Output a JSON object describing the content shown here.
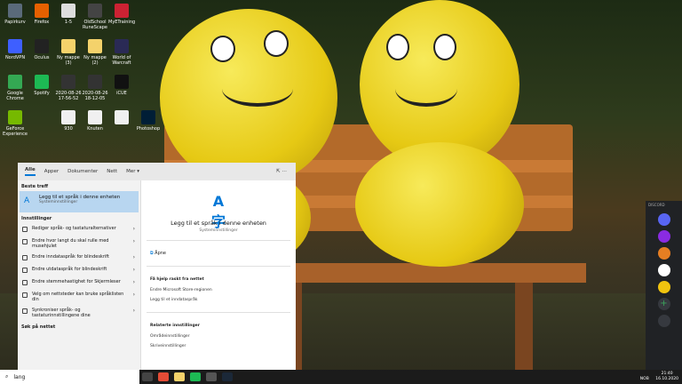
{
  "desktop_icons": [
    {
      "label": "Papirkurv",
      "color": "#5a6a7a"
    },
    {
      "label": "Firefox",
      "color": "#e66000"
    },
    {
      "label": "1-5",
      "color": "#dddddd"
    },
    {
      "label": "OldSchool RuneScape",
      "color": "#444444"
    },
    {
      "label": "MyETraining",
      "color": "#cc2233"
    },
    {
      "label": "NordVPN",
      "color": "#3e5fff"
    },
    {
      "label": "Oculus",
      "color": "#222222"
    },
    {
      "label": "Ny mappe (3)",
      "color": "#f4d26b"
    },
    {
      "label": "Ny mappe (2)",
      "color": "#f4d26b"
    },
    {
      "label": "World of Warcraft",
      "color": "#2a2a55"
    },
    {
      "label": "Google Chrome",
      "color": "#34a853"
    },
    {
      "label": "Spotify",
      "color": "#1db954"
    },
    {
      "label": "2020-08-26 17-56-52",
      "color": "#333333"
    },
    {
      "label": "2020-08-26 18-12-05",
      "color": "#333333"
    },
    {
      "label": "iCUE",
      "color": "#111111"
    },
    {
      "label": "GeForce Experience",
      "color": "#76b900"
    },
    {
      "label": "930",
      "color": "#f0f0f0"
    },
    {
      "label": "Knuten",
      "color": "#f0f0f0"
    },
    {
      "label": "",
      "color": "#f0f0f0"
    },
    {
      "label": "Photoshop",
      "color": "#001e36"
    }
  ],
  "start_menu": {
    "tabs": [
      "Alle",
      "Apper",
      "Dokumenter",
      "Nett",
      "Mer ▾"
    ],
    "best_match_heading": "Beste treff",
    "best_match": {
      "title": "Legg til et språk i denne enheten",
      "subtitle": "Systeminnstillinger"
    },
    "settings_heading": "Innstillinger",
    "settings_items": [
      "Rediger språk- og tastaturalternativer",
      "Endre hvor langt du skal rulle med musehjulet",
      "Endre inndataspråk for blindeskrift",
      "Endre utdataspråk for blindeskrift",
      "Endre stemmehastighet for Skjermleser",
      "Velg om nettsteder kan bruke språklisten din",
      "Synkroniser språk- og tastaturinnstillingene dine"
    ],
    "web_heading": "Søk på nettet",
    "preview": {
      "title": "Legg til et språk i denne enheten",
      "subtitle": "Systeminnstillinger",
      "open_action": "Åpne",
      "quick_help_heading": "Få hjelp raskt fra nettet",
      "quick_help_links": [
        "Endre Microsoft Store-regionen",
        "Legg til et inndataspråk"
      ],
      "related_heading": "Relaterte innstillinger",
      "related_links": [
        "Områdeinnstillinger",
        "Skriveinnstillinger"
      ]
    }
  },
  "taskbar": {
    "search_value": "lang",
    "tray_lang": "NOB",
    "time": "21:40",
    "date": "16.10.2020"
  },
  "discord": {
    "title": "DISCORD"
  },
  "colors": {
    "accent": "#0078d7",
    "taskbar": "#1b1b1b",
    "menu_bg": "#f2f2f2"
  }
}
